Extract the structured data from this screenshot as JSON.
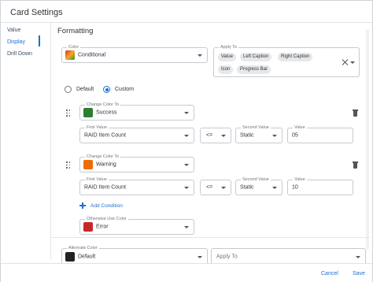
{
  "window": {
    "title": "Card Settings"
  },
  "sidebar": {
    "items": [
      {
        "label": "Value"
      },
      {
        "label": "Display"
      },
      {
        "label": "Drill Down"
      }
    ],
    "active": "Display"
  },
  "main": {
    "heading": "Formatting",
    "color": {
      "label": "Color",
      "value": "Conditional",
      "swatch": "conditional"
    },
    "apply_to": {
      "label": "Apply To",
      "chips": [
        "Value",
        "Left Caption",
        "Right Caption",
        "Icon",
        "Progress Bar"
      ]
    },
    "mode": {
      "options": [
        "Default",
        "Custom"
      ],
      "selected": "Custom"
    },
    "conditions": [
      {
        "change_color_label": "Change Color To",
        "color_name": "Success",
        "color_hex": "#2e7d32",
        "first_value_label": "First Value",
        "first_value": "RAID Item Count",
        "operator": "<=",
        "second_value_label": "Second Value",
        "second_value": "Static",
        "value_label": "Value",
        "value": "05"
      },
      {
        "change_color_label": "Change Color To",
        "color_name": "Warning",
        "color_hex": "#ef6c00",
        "first_value_label": "First Value",
        "first_value": "RAID Item Count",
        "operator": "<=",
        "second_value_label": "Second Value",
        "second_value": "Static",
        "value_label": "Value",
        "value": "10"
      }
    ],
    "add_condition": "Add Condition",
    "otherwise": {
      "label": "Otherwise Use Color",
      "value": "Error",
      "color_hex": "#c62828"
    },
    "alternate": {
      "label": "Alternate Color",
      "value": "Default",
      "color_hex": "#222222",
      "apply_to_placeholder": "Apply To"
    }
  },
  "footer": {
    "cancel": "Cancel",
    "save": "Save"
  },
  "colors": {
    "accent": "#1e6fd0",
    "border": "#c5cad1"
  },
  "icons": [
    "close-icon",
    "chevron-down-icon",
    "drag-handle-icon",
    "trash-icon",
    "plus-icon"
  ]
}
